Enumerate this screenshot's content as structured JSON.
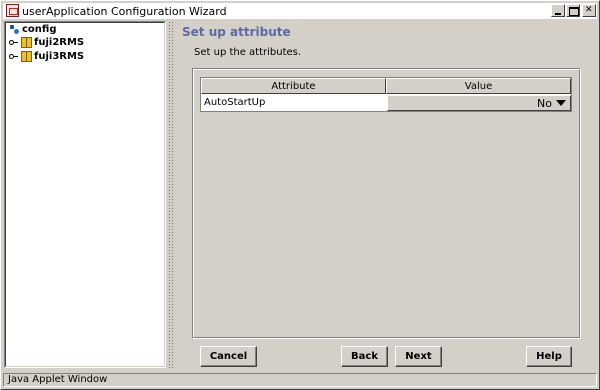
{
  "window": {
    "title": "userApplication Configuration Wizard",
    "controls": [
      "minimize",
      "maximize",
      "close"
    ]
  },
  "tree": {
    "root": "config",
    "nodes": [
      {
        "label": "fuji2RMS"
      },
      {
        "label": "fuji3RMS"
      }
    ]
  },
  "main": {
    "heading": "Set up attribute",
    "subtitle": "Set up the attributes.",
    "table": {
      "columns": [
        "Attribute",
        "Value"
      ],
      "rows": [
        {
          "attribute": "AutoStartUp",
          "value": "No"
        }
      ]
    }
  },
  "buttons": {
    "cancel": "Cancel",
    "back": "Back",
    "next": "Next",
    "help": "Help"
  },
  "status": {
    "text": "Java Applet Window"
  },
  "colors": {
    "background": "#d4d0c8",
    "heading": "#5a6aa8"
  }
}
